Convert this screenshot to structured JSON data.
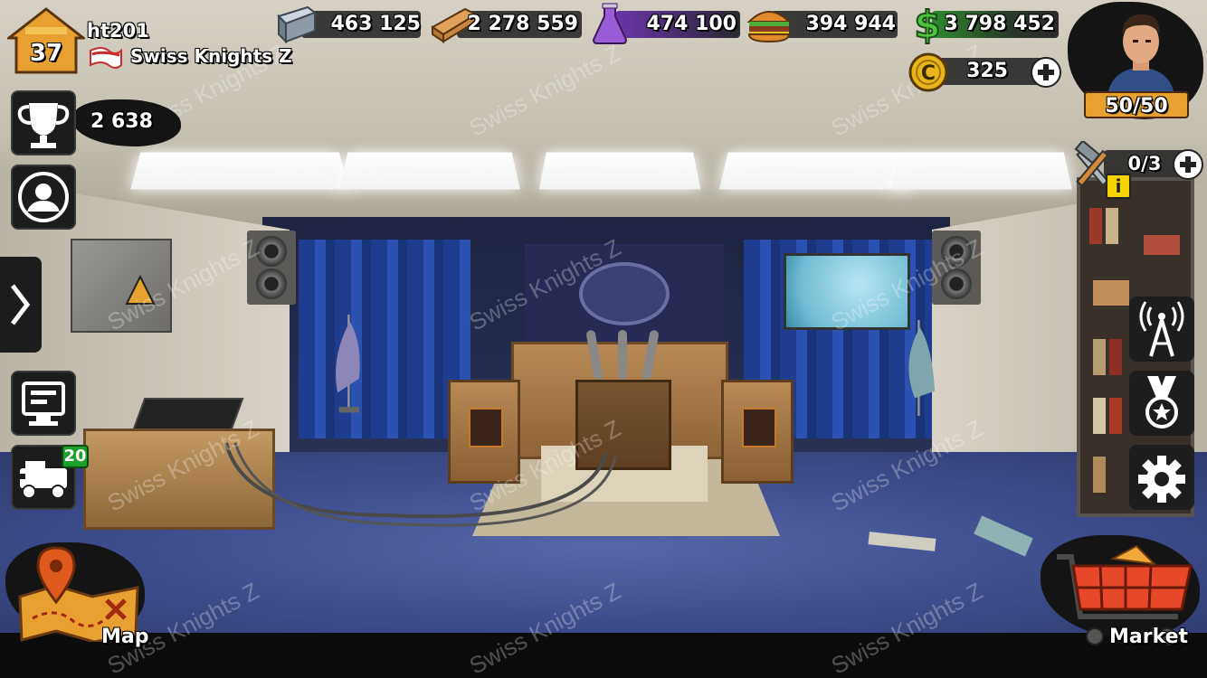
{
  "player": {
    "name": "ht201",
    "level": "37",
    "clan_name": "Swiss Knights Z",
    "trophies": "2 638",
    "energy": "50/50"
  },
  "resources": {
    "steel": "463 125",
    "wood": "2 278 559",
    "chemicals": "474 100",
    "food": "394 944",
    "cash": "3 798 452",
    "coins": "325"
  },
  "builders": {
    "count": "0/3",
    "info_badge": "i"
  },
  "left_menu": {
    "vehicles_badge": "20"
  },
  "bottom": {
    "map_label": "Map",
    "market_label": "Market"
  },
  "watermark": "Swiss Knights Z",
  "colors": {
    "level_badge": "#e8a030",
    "energy_bar": "#e6a12e",
    "vehicles_badge": "#1e9e2a",
    "chemical_bar": "#6a35a8",
    "cash_bar": "#2f8a2f",
    "info_badge": "#f5d400"
  },
  "icons": [
    "house-icon",
    "flag-icon",
    "steel-beam-icon",
    "lumber-icon",
    "flask-icon",
    "burger-icon",
    "dollar-icon",
    "coin-icon",
    "plus-icon",
    "trophy-icon",
    "profile-icon",
    "chevron-right-icon",
    "monitor-icon",
    "vehicle-icon",
    "hammer-wrench-icon",
    "radio-tower-icon",
    "medal-icon",
    "gear-icon",
    "map-icon",
    "cart-icon"
  ]
}
